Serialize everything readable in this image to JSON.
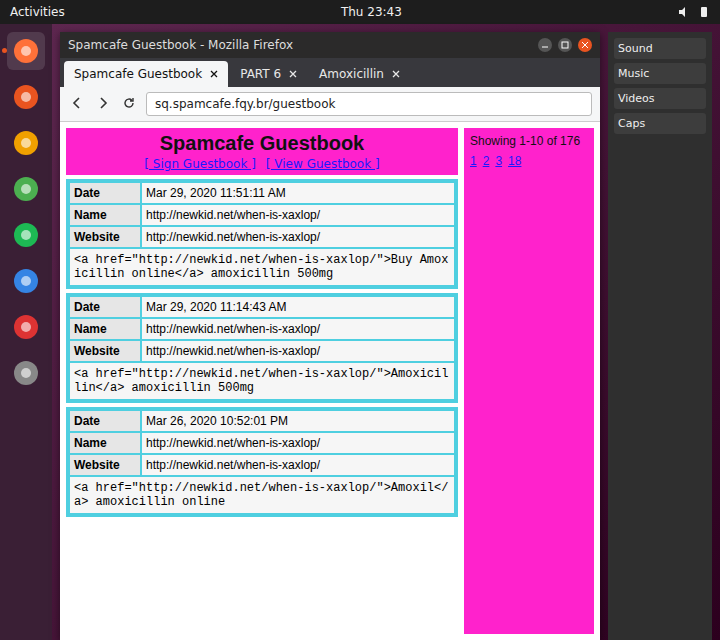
{
  "top_bar": {
    "activities": "Activities",
    "clock": "Thu 23:43"
  },
  "dock": {
    "items": [
      {
        "running": true
      },
      {
        "running": false
      },
      {
        "running": false
      },
      {
        "running": false
      },
      {
        "running": false
      },
      {
        "running": false
      },
      {
        "running": false
      },
      {
        "running": false
      }
    ]
  },
  "window": {
    "title": "Spamcafe Guestbook - Mozilla Firefox"
  },
  "tabs": [
    {
      "label": "Spamcafe Guestbook",
      "selected": true
    },
    {
      "label": "PART 6",
      "selected": false
    },
    {
      "label": "Amoxicillin",
      "selected": false
    }
  ],
  "address_bar": {
    "url": "sq.spamcafe.fqy.br/guestbook"
  },
  "page": {
    "title": "Spamcafe Guestbook",
    "links": [
      "[ Sign Guestbook ]",
      "[ View Guestbook ]"
    ],
    "labels": {
      "date": "Date",
      "name": "Name",
      "website": "Website"
    },
    "entries": [
      {
        "date": "Mar 29, 2020 11:51:11 AM",
        "name": "http://newkid.net/when-is-xaxlop/",
        "website": "http://newkid.net/when-is-xaxlop/",
        "message": "<a href=\"http://newkid.net/when-is-xaxlop/\">Buy Amoxicillin online</a> amoxicillin 500mg"
      },
      {
        "date": "Mar 29, 2020 11:14:43 AM",
        "name": "http://newkid.net/when-is-xaxlop/",
        "website": "http://newkid.net/when-is-xaxlop/",
        "message": "<a href=\"http://newkid.net/when-is-xaxlop/\">Amoxicillin</a> amoxicillin 500mg"
      },
      {
        "date": "Mar 26, 2020 10:52:01 PM",
        "name": "http://newkid.net/when-is-xaxlop/",
        "website": "http://newkid.net/when-is-xaxlop/",
        "message": "<a href=\"http://newkid.net/when-is-xaxlop/\">Amoxil</a> amoxicillin online"
      }
    ],
    "side": {
      "showing": "Showing 1-10 of 176",
      "pages": [
        "1",
        "2",
        "3",
        "18"
      ]
    }
  },
  "right_window": {
    "items": [
      "Sound",
      "Music",
      "Videos",
      "Caps"
    ]
  }
}
